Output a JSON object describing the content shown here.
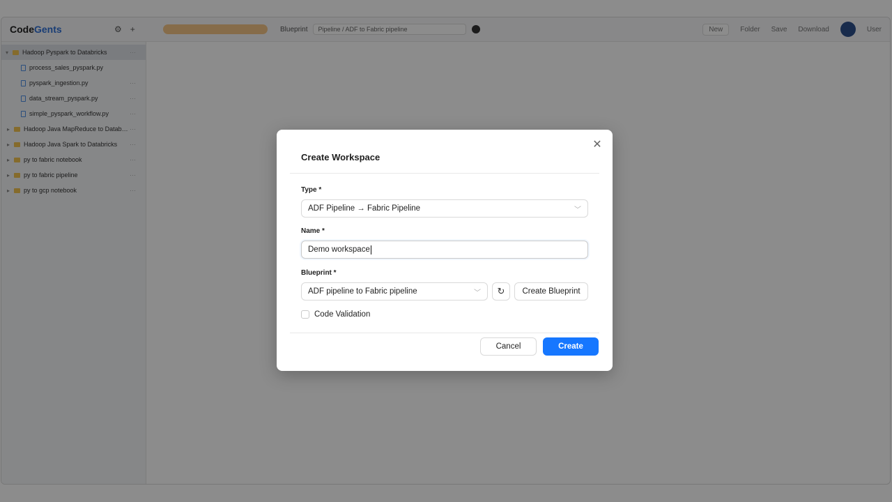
{
  "app": {
    "logo_part1": "Code",
    "logo_part2": "Gents"
  },
  "topbar": {
    "project_label": "Blueprint",
    "project_select": "Pipeline / ADF to Fabric pipeline",
    "right_actions": [
      "New",
      "Folder",
      "Save",
      "Download",
      "User"
    ]
  },
  "sidebar": {
    "items": [
      {
        "label": "Hadoop Pyspark to Databricks",
        "kind": "folder",
        "selected": true
      },
      {
        "label": "process_sales_pyspark.py",
        "kind": "file"
      },
      {
        "label": "pyspark_ingestion.py",
        "kind": "file"
      },
      {
        "label": "data_stream_pyspark.py",
        "kind": "file"
      },
      {
        "label": "simple_pyspark_workflow.py",
        "kind": "file"
      },
      {
        "label": "Hadoop Java MapReduce to Databricks",
        "kind": "folder"
      },
      {
        "label": "Hadoop Java Spark to Databricks",
        "kind": "folder"
      },
      {
        "label": "py to fabric notebook",
        "kind": "folder"
      },
      {
        "label": "py to fabric pipeline",
        "kind": "folder"
      },
      {
        "label": "py to gcp notebook",
        "kind": "folder"
      }
    ]
  },
  "modal": {
    "title": "Create Workspace",
    "type_label": "Type *",
    "type_value": "ADF Pipeline → Fabric Pipeline",
    "name_label": "Name *",
    "name_value": "Demo workspace",
    "blueprint_label": "Blueprint *",
    "blueprint_value": "ADF pipeline to Fabric pipeline",
    "create_blueprint_label": "Create Blueprint",
    "code_validation_label": "Code Validation",
    "code_validation_checked": false,
    "cancel_label": "Cancel",
    "create_label": "Create"
  },
  "colors": {
    "primary": "#1677ff",
    "overlay": "rgba(0,0,0,0.45)"
  }
}
